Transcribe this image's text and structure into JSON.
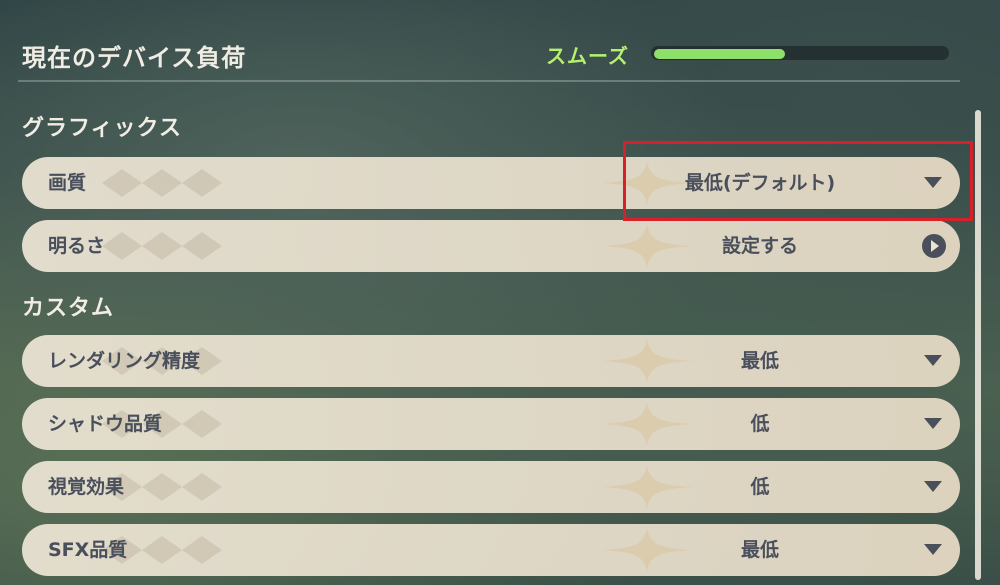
{
  "device_load": {
    "title": "現在のデバイス負荷",
    "status": "スムーズ",
    "level_fraction": 0.45,
    "status_color": "#b6f06f",
    "bar_color": "#8fe06a"
  },
  "sections": {
    "graphics": {
      "title": "グラフィックス",
      "rows": [
        {
          "label": "画質",
          "value": "最低(デフォルト)",
          "control": "dropdown"
        },
        {
          "label": "明るさ",
          "value": "設定する",
          "control": "navigate"
        }
      ]
    },
    "custom": {
      "title": "カスタム",
      "rows": [
        {
          "label": "レンダリング精度",
          "value": "最低",
          "control": "dropdown"
        },
        {
          "label": "シャドウ品質",
          "value": "低",
          "control": "dropdown"
        },
        {
          "label": "視覚効果",
          "value": "低",
          "control": "dropdown"
        },
        {
          "label": "SFX品質",
          "value": "最低",
          "control": "dropdown"
        }
      ]
    }
  },
  "icons": {
    "dropdown": "chevron-down-icon",
    "navigate": "arrow-right-circle-icon"
  },
  "highlight_color": "#d8202a"
}
